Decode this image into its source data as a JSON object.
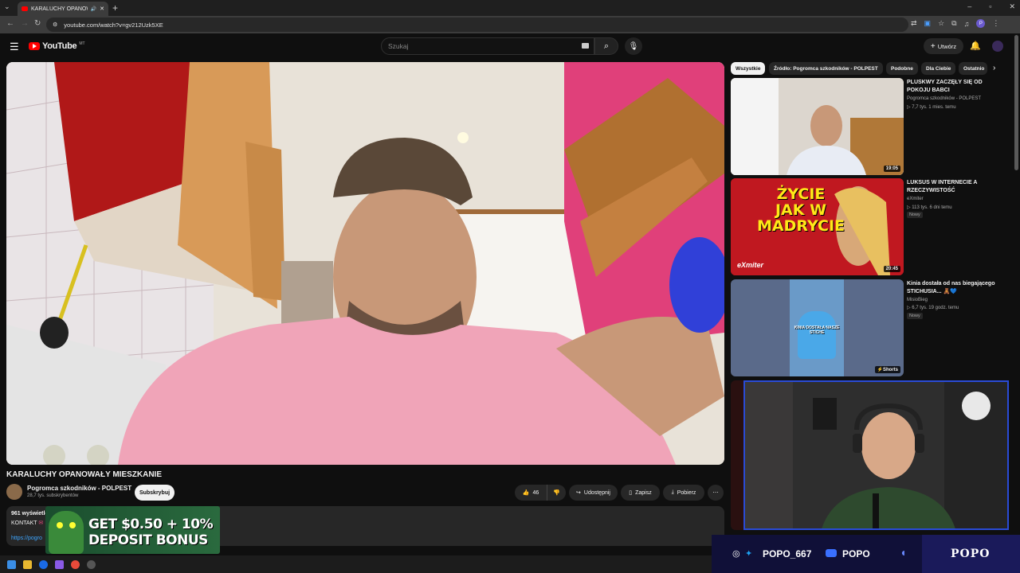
{
  "browser": {
    "tab_title": "KARALUCHY OPANOWAŁY",
    "url": "youtube.com/watch?v=gv212Uzk5XE",
    "profile_initial": "P"
  },
  "header": {
    "logo_text": "YouTube",
    "logo_country": "MT",
    "search_placeholder": "Szukaj",
    "create_label": "Utwórz"
  },
  "video": {
    "title": "KARALUCHY OPANOWAŁY MIESZKANIE",
    "channel": "Pogromca szkodników - POLPEST",
    "subscribers": "28,7 tys. subskrybentów",
    "subscribe_label": "Subskrybuj",
    "likes": "46",
    "share_label": "Udostępnij",
    "save_label": "Zapisz",
    "download_label": "Pobierz",
    "views_text": "961 wyświetleń",
    "description_line": "KONTAKT",
    "description_link": "https://pogro"
  },
  "ad": {
    "line1": "GET $0.50 + 10%",
    "line2": "DEPOSIT BONUS"
  },
  "sidebar": {
    "chips": [
      {
        "label": "Wszystkie"
      },
      {
        "label": "Źródło: Pogromca szkodników - POLPEST"
      },
      {
        "label": "Podobne"
      },
      {
        "label": "Dla Ciebie"
      },
      {
        "label": "Ostatnio"
      }
    ],
    "items": [
      {
        "title": "PLUSKWY ZACZĘŁY SIĘ OD POKOJU BABCI",
        "channel": "Pogromca szkodników - POLPEST",
        "meta": "7,7 tys.   1 mies. temu",
        "duration": "19:05",
        "badge": ""
      },
      {
        "title": "LUKSUS W INTERNECIE A RZECZYWISTOŚĆ",
        "channel": "eXmiter",
        "meta": "113 tys.   6 dni temu",
        "duration": "20:45",
        "badge": "Nowy",
        "thumb_line1": "ŻYCIE",
        "thumb_line2": "JAK W",
        "thumb_line3": "MADRYCIE",
        "thumb_brand": "eXmiter"
      },
      {
        "title": "Kinia dostała od nas biegającego STICHUSIA... 🧸💙",
        "channel": "MisioBieg",
        "meta": "6,7 tys.   19 godz. temu",
        "duration": "Shorts",
        "badge": "Nowy",
        "thumb_caption": "KINIA DOSTAŁA NASZE STICHE"
      }
    ]
  },
  "overlay": {
    "instagram_twitter_handle": "POPO_667",
    "youtube_handle": "POPO",
    "brand": "POPO"
  },
  "colors": {
    "youtube_red": "#ff0000",
    "link_blue": "#3ea6ff",
    "overlay_border": "#2a4bd6"
  }
}
